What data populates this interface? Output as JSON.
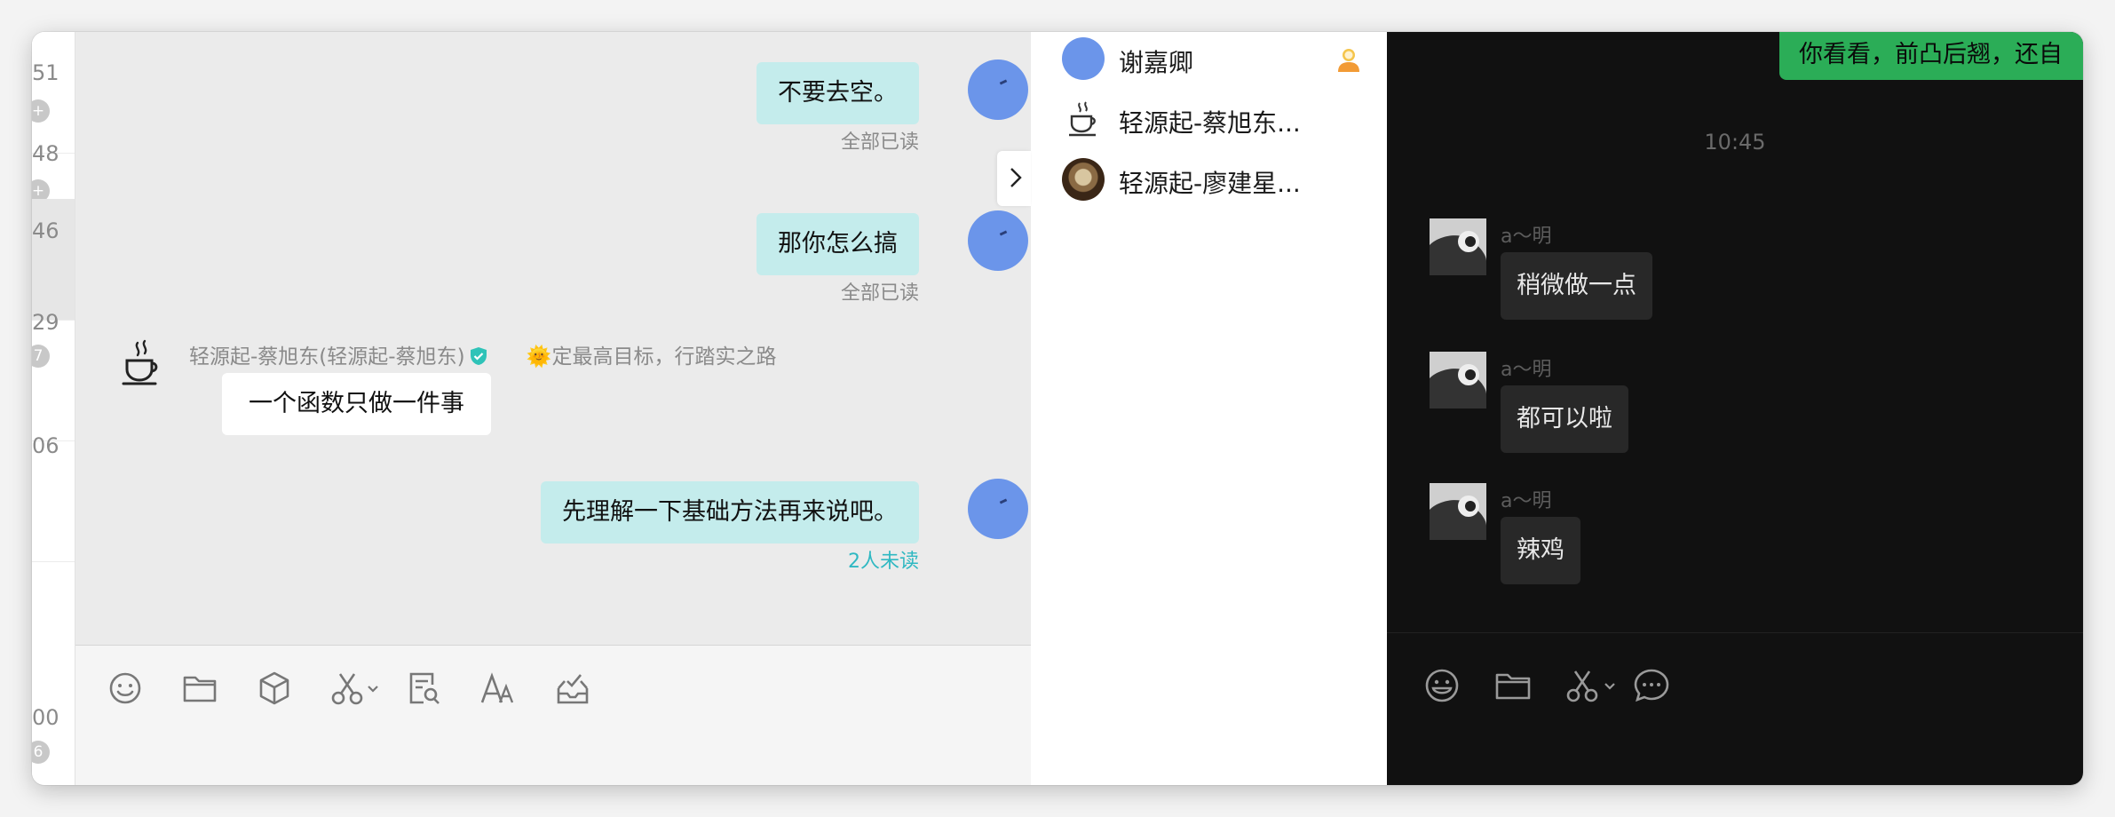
{
  "conversation_list": {
    "rows": [
      {
        "time": "51",
        "badge": "+"
      },
      {
        "time": "48",
        "badge": "+"
      },
      {
        "time": "46",
        "badge": ""
      },
      {
        "time": "29",
        "badge": "7"
      },
      {
        "time": "06",
        "badge": ""
      },
      {
        "time": "00",
        "badge": "6"
      }
    ]
  },
  "chat": {
    "messages": [
      {
        "text": "不要去空。",
        "status": "全部已读"
      },
      {
        "text": "那你怎么搞",
        "status": "全部已读"
      },
      {
        "sender": "轻源起-蔡旭东(轻源起-蔡旭东)",
        "signature": "🌞定最高目标，行踏实之路",
        "text": "一个函数只做一件事"
      },
      {
        "text": "先理解一下基础方法再来说吧。",
        "status": "2人未读"
      }
    ]
  },
  "members": [
    {
      "name": "谢嘉卿"
    },
    {
      "name": "轻源起-蔡旭东..."
    },
    {
      "name": "轻源起-廖建星..."
    }
  ],
  "dark_chat": {
    "top_partial_message": "你看看，前凸后翘，还自",
    "timestamp": "10:45",
    "messages": [
      {
        "sender": "a～明",
        "text": "稍微做一点"
      },
      {
        "sender": "a～明",
        "text": "都可以啦"
      },
      {
        "sender": "a～明",
        "text": "辣鸡"
      }
    ]
  },
  "colors": {
    "outgoing_bubble": "#c4ecec",
    "unread_status": "#2fb8c2",
    "avatar_blue": "#6b95ea",
    "dark_background": "#111111",
    "green_bubble": "#2bad57"
  }
}
